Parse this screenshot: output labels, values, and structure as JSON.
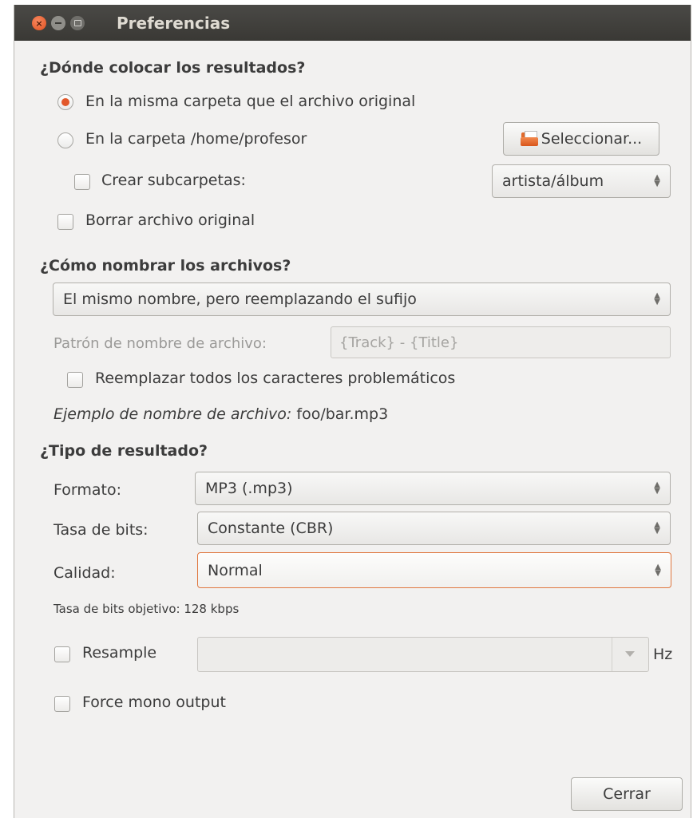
{
  "window": {
    "title": "Preferencias"
  },
  "where": {
    "heading": "¿Dónde colocar los resultados?",
    "option_same_folder": "En la misma carpeta que el archivo original",
    "option_folder": "En la carpeta /home/profesor",
    "select_button": "Seleccionar...",
    "create_subfolders": "Crear subcarpetas:",
    "subfolder_pattern": "artista/álbum",
    "delete_original": "Borrar archivo original",
    "selected_option": "same_folder"
  },
  "naming": {
    "heading": "¿Cómo nombrar los archivos?",
    "method": "El mismo nombre, pero reemplazando el sufijo",
    "pattern_label": "Patrón de nombre de archivo:",
    "pattern_value": "{Track} - {Title}",
    "replace_chars": "Reemplazar todos los caracteres problemáticos",
    "example_label": "Ejemplo de nombre de archivo:",
    "example_value": "foo/bar.mp3"
  },
  "output": {
    "heading": "¿Tipo de resultado?",
    "format_label": "Formato:",
    "format_value": "MP3 (.mp3)",
    "bitrate_label": "Tasa de bits:",
    "bitrate_value": "Constante (CBR)",
    "quality_label": "Calidad:",
    "quality_value": "Normal",
    "target_bitrate": "Tasa de bits objetivo: 128 kbps",
    "resample_label": "Resample",
    "resample_unit": "Hz",
    "mono_label": "Force mono output"
  },
  "footer": {
    "close_button": "Cerrar"
  },
  "colors": {
    "accent": "#e2582b",
    "titlebar": "#3c3b37",
    "window_bg": "#f2f1f0"
  }
}
